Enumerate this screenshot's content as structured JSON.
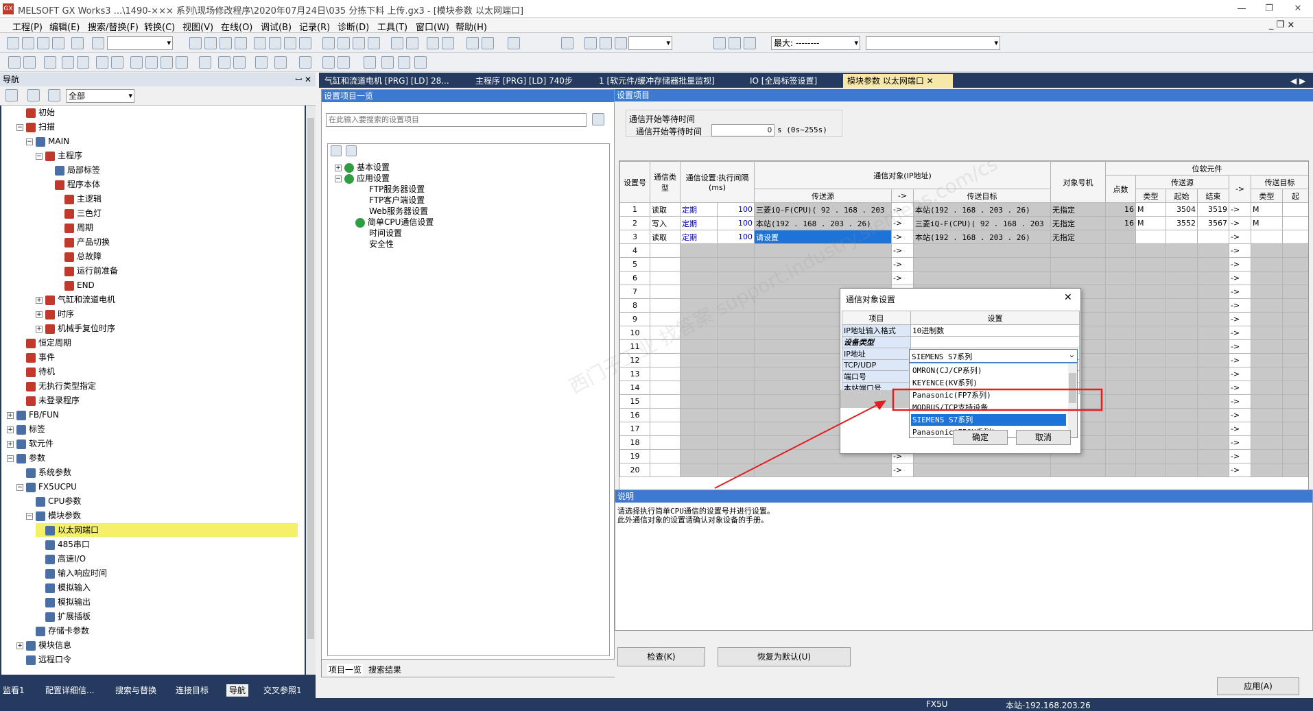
{
  "window": {
    "title": "MELSOFT GX Works3 ...\\1490-××× 系列\\现场修改程序\\2020年07月24日\\035 分拣下料 上传.gx3 - [模块参数 以太网端口]",
    "icon_label": "GX",
    "minimize": "—",
    "restore": "❐",
    "close": "✕",
    "mdi_controls": "_ ❐ ×"
  },
  "menu": [
    "工程(P)",
    "编辑(E)",
    "搜索/替换(F)",
    "转换(C)",
    "视图(V)",
    "在线(O)",
    "调试(B)",
    "记录(R)",
    "诊断(D)",
    "工具(T)",
    "窗口(W)",
    "帮助(H)"
  ],
  "toolbar": {
    "zoom_select": "最大: --------"
  },
  "nav": {
    "title": "导航",
    "pin": "ꟷ ✕",
    "filter": "全部"
  },
  "tree": [
    {
      "label": "初始",
      "indent": 1,
      "exp": "",
      "color": "#c0392b"
    },
    {
      "label": "扫描",
      "indent": 1,
      "exp": "−",
      "color": "#c0392b"
    },
    {
      "label": "MAIN",
      "indent": 2,
      "exp": "−",
      "color": "#4a6fa5"
    },
    {
      "label": "主程序",
      "indent": 3,
      "exp": "−",
      "color": "#c0392b"
    },
    {
      "label": "局部标签",
      "indent": 4,
      "exp": "",
      "color": "#4a6fa5"
    },
    {
      "label": "程序本体",
      "indent": 4,
      "exp": "",
      "color": "#c0392b"
    },
    {
      "label": "主逻辑",
      "indent": 5,
      "exp": "",
      "color": "#c0392b"
    },
    {
      "label": "三色灯",
      "indent": 5,
      "exp": "",
      "color": "#c0392b"
    },
    {
      "label": "周期",
      "indent": 5,
      "exp": "",
      "color": "#c0392b"
    },
    {
      "label": "产品切换",
      "indent": 5,
      "exp": "",
      "color": "#c0392b"
    },
    {
      "label": "总故障",
      "indent": 5,
      "exp": "",
      "color": "#c0392b"
    },
    {
      "label": "运行前准备",
      "indent": 5,
      "exp": "",
      "color": "#c0392b"
    },
    {
      "label": "END",
      "indent": 5,
      "exp": "",
      "color": "#c0392b"
    },
    {
      "label": "气缸和流道电机",
      "indent": 3,
      "exp": "+",
      "color": "#c0392b"
    },
    {
      "label": "时序",
      "indent": 3,
      "exp": "+",
      "color": "#c0392b"
    },
    {
      "label": "机械手复位时序",
      "indent": 3,
      "exp": "+",
      "color": "#c0392b"
    },
    {
      "label": "恒定周期",
      "indent": 1,
      "exp": "",
      "color": "#c0392b"
    },
    {
      "label": "事件",
      "indent": 1,
      "exp": "",
      "color": "#c0392b"
    },
    {
      "label": "待机",
      "indent": 1,
      "exp": "",
      "color": "#c0392b"
    },
    {
      "label": "无执行类型指定",
      "indent": 1,
      "exp": "",
      "color": "#c0392b"
    },
    {
      "label": "未登录程序",
      "indent": 1,
      "exp": "",
      "color": "#c0392b"
    },
    {
      "label": "FB/FUN",
      "indent": 0,
      "exp": "+",
      "color": "#4a6fa5"
    },
    {
      "label": "标签",
      "indent": 0,
      "exp": "+",
      "color": "#4a6fa5"
    },
    {
      "label": "软元件",
      "indent": 0,
      "exp": "+",
      "color": "#4a6fa5"
    },
    {
      "label": "参数",
      "indent": 0,
      "exp": "−",
      "color": "#4a6fa5"
    },
    {
      "label": "系统参数",
      "indent": 1,
      "exp": "",
      "color": "#4a6fa5"
    },
    {
      "label": "FX5UCPU",
      "indent": 1,
      "exp": "−",
      "color": "#4a6fa5"
    },
    {
      "label": "CPU参数",
      "indent": 2,
      "exp": "",
      "color": "#4a6fa5"
    },
    {
      "label": "模块参数",
      "indent": 2,
      "exp": "−",
      "color": "#4a6fa5"
    },
    {
      "label": "以太网端口",
      "indent": 3,
      "exp": "",
      "color": "#4a6fa5",
      "selected": true
    },
    {
      "label": "485串口",
      "indent": 3,
      "exp": "",
      "color": "#4a6fa5"
    },
    {
      "label": "高速I/O",
      "indent": 3,
      "exp": "",
      "color": "#4a6fa5"
    },
    {
      "label": "输入响应时间",
      "indent": 3,
      "exp": "",
      "color": "#4a6fa5"
    },
    {
      "label": "模拟输入",
      "indent": 3,
      "exp": "",
      "color": "#4a6fa5"
    },
    {
      "label": "模拟输出",
      "indent": 3,
      "exp": "",
      "color": "#4a6fa5"
    },
    {
      "label": "扩展插板",
      "indent": 3,
      "exp": "",
      "color": "#4a6fa5"
    },
    {
      "label": "存储卡参数",
      "indent": 2,
      "exp": "",
      "color": "#4a6fa5"
    },
    {
      "label": "模块信息",
      "indent": 1,
      "exp": "+",
      "color": "#4a6fa5"
    },
    {
      "label": "远程口令",
      "indent": 1,
      "exp": "",
      "color": "#4a6fa5"
    }
  ],
  "bottom_tabs": [
    "监看1",
    "配置详细信...",
    "搜索与替换",
    "连接目标",
    "导航",
    "交叉参照1"
  ],
  "doc_tabs": [
    "气缸和流道电机 [PRG] [LD] 28...",
    "主程序 [PRG] [LD] 740步",
    "1 [软元件/缓冲存储器批量监视]",
    "IO [全局标签设置]",
    "模块参数 以太网端口"
  ],
  "doc_tab_close": "✕",
  "doc_tab_nav": "◀ ▶",
  "middle": {
    "header": "设置项目一览",
    "search_placeholder": "在此输入要搜索的设置项目",
    "items": [
      "基本设置",
      "应用设置",
      "FTP服务器设置",
      "FTP客户端设置",
      "Web服务器设置",
      "简单CPU通信设置",
      "时间设置",
      "安全性"
    ],
    "tabs": [
      "项目一览",
      "搜索结果"
    ]
  },
  "right": {
    "header": "设置项目",
    "wait_group": "通信开始等待时间",
    "wait_label": "通信开始等待时间",
    "wait_value": "0",
    "wait_unit": "s (0s~255s)"
  },
  "grid": {
    "h_no": "设置号",
    "h_type": "通信类型",
    "h_interval": "通信设置:执行间隔(ms)",
    "h_target": "通信对象(IP地址)",
    "h_src": "传送源",
    "h_arrow": "->",
    "h_dst": "传送目标",
    "h_station": "对象号机",
    "h_bit": "位软元件",
    "h_points": "点数",
    "h_bsrc": "传送源",
    "h_btype": "类型",
    "h_bstart": "起始",
    "h_bend": "结束",
    "h_bdst": "传送目标",
    "h_bdtype": "类型",
    "h_bdstart": "起",
    "rows": [
      {
        "no": "1",
        "type": "读取",
        "mode": "定期",
        "ms": "100",
        "src": "三菱iQ-F(CPU)( 92 . 168 . 203 .",
        "dst": "本站(192 . 168 . 203 . 26)",
        "station": "无指定",
        "points": "16",
        "btype": "M",
        "bstart": "3504",
        "bend": "3519",
        "bdtype": "M"
      },
      {
        "no": "2",
        "type": "写入",
        "mode": "定期",
        "ms": "100",
        "src": "本站(192 . 168 . 203 . 26)",
        "dst": "三菱iQ-F(CPU)( 92 . 168 . 203 .",
        "station": "无指定",
        "points": "16",
        "btype": "M",
        "bstart": "3552",
        "bend": "3567",
        "bdtype": "M"
      },
      {
        "no": "3",
        "type": "读取",
        "mode": "定期",
        "ms": "100",
        "src": "请设置",
        "dst": "本站(192 . 168 . 203 . 26)",
        "station": "无指定",
        "points": "",
        "btype": "",
        "bstart": "",
        "bend": "",
        "bdtype": ""
      }
    ],
    "empty_rows": [
      "4",
      "5",
      "6",
      "7",
      "8",
      "9",
      "10",
      "11",
      "12",
      "13",
      "14",
      "15",
      "16",
      "17",
      "18",
      "19",
      "20"
    ]
  },
  "desc": {
    "header": "说明",
    "line1": "请选择执行简单CPU通信的设置号并进行设置。",
    "line2": "此外通信对象的设置请确认对象设备的手册。"
  },
  "buttons": {
    "check": "检查(K)",
    "restore": "恢复为默认(U)",
    "apply": "应用(A)"
  },
  "dialog": {
    "title": "通信对象设置",
    "close": "✕",
    "col_item": "项目",
    "col_setting": "设置",
    "rows": [
      {
        "item": "IP地址输入格式",
        "value": "10进制数"
      },
      {
        "item": "设备类型",
        "value": "SIEMENS  S7系列"
      },
      {
        "item": "IP地址",
        "value": ""
      },
      {
        "item": "TCP/UDP",
        "value": ""
      },
      {
        "item": "端口号",
        "value": ""
      },
      {
        "item": "本站端口号",
        "value": ""
      }
    ],
    "options": [
      "OMRON(CJ/CP系列)",
      "KEYENCE(KV系列)",
      "Panasonic(FP7系列)",
      "MODBUS/TCP支持设备",
      "SIEMENS  S7系列",
      "Panasonic(FPOH系列)"
    ],
    "selected_index": 4,
    "ok": "确定",
    "cancel": "取消"
  },
  "watermark": "西门子工业 找答案  support.industry.siemens.com/cs",
  "status": {
    "cpu": "FX5U",
    "station": "本站-192.168.203.26"
  },
  "colors": {
    "nav_bg": "#243a5e",
    "accent_blue": "#3b7ad0",
    "highlight_red": "#e02020",
    "selection_yellow": "#f5f06a"
  }
}
